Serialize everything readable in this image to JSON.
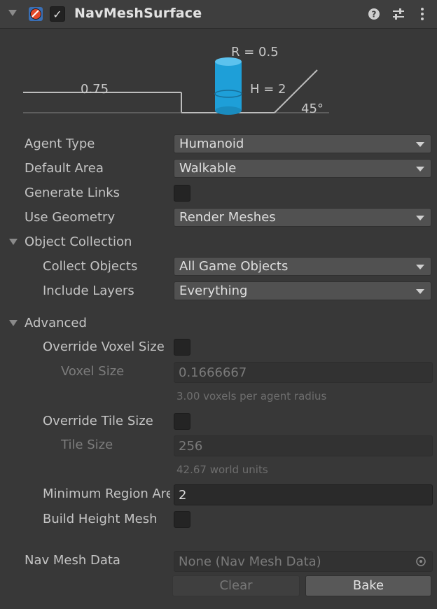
{
  "component": {
    "title": "NavMeshSurface",
    "enabled_checkmark": "✓",
    "icons": {
      "fold": "fold-arrow-icon",
      "component": "navmesh-component-icon",
      "help": "help-icon",
      "presets": "presets-sliders-icon",
      "menu": "kebab-menu-icon"
    }
  },
  "diagram": {
    "radius_label": "R = 0.5",
    "height_label": "H = 2",
    "step_label": "0.75",
    "slope_label": "45°",
    "cylinder_color": "#1e9fd8"
  },
  "fields": {
    "agent_type": {
      "label": "Agent Type",
      "value": "Humanoid"
    },
    "default_area": {
      "label": "Default Area",
      "value": "Walkable"
    },
    "generate_links": {
      "label": "Generate Links",
      "checked": false
    },
    "use_geometry": {
      "label": "Use Geometry",
      "value": "Render Meshes"
    }
  },
  "object_collection": {
    "header": "Object Collection",
    "collect_objects": {
      "label": "Collect Objects",
      "value": "All Game Objects"
    },
    "include_layers": {
      "label": "Include Layers",
      "value": "Everything"
    }
  },
  "advanced": {
    "header": "Advanced",
    "override_voxel_size": {
      "label": "Override Voxel Size",
      "checked": false
    },
    "voxel_size": {
      "label": "Voxel Size",
      "value": "0.1666667",
      "help": "3.00 voxels per agent radius"
    },
    "override_tile_size": {
      "label": "Override Tile Size",
      "checked": false
    },
    "tile_size": {
      "label": "Tile Size",
      "value": "256",
      "help": "42.67 world units"
    },
    "min_region_area": {
      "label": "Minimum Region Area",
      "value": "2"
    },
    "build_height_mesh": {
      "label": "Build Height Mesh",
      "checked": false
    }
  },
  "nav_mesh_data": {
    "label": "Nav Mesh Data",
    "value": "None (Nav Mesh Data)"
  },
  "buttons": {
    "clear": "Clear",
    "bake": "Bake"
  },
  "colors": {
    "background": "#383838",
    "header": "#3e3e3e",
    "dropdown": "#515151",
    "accent": "#1e9fd8"
  }
}
